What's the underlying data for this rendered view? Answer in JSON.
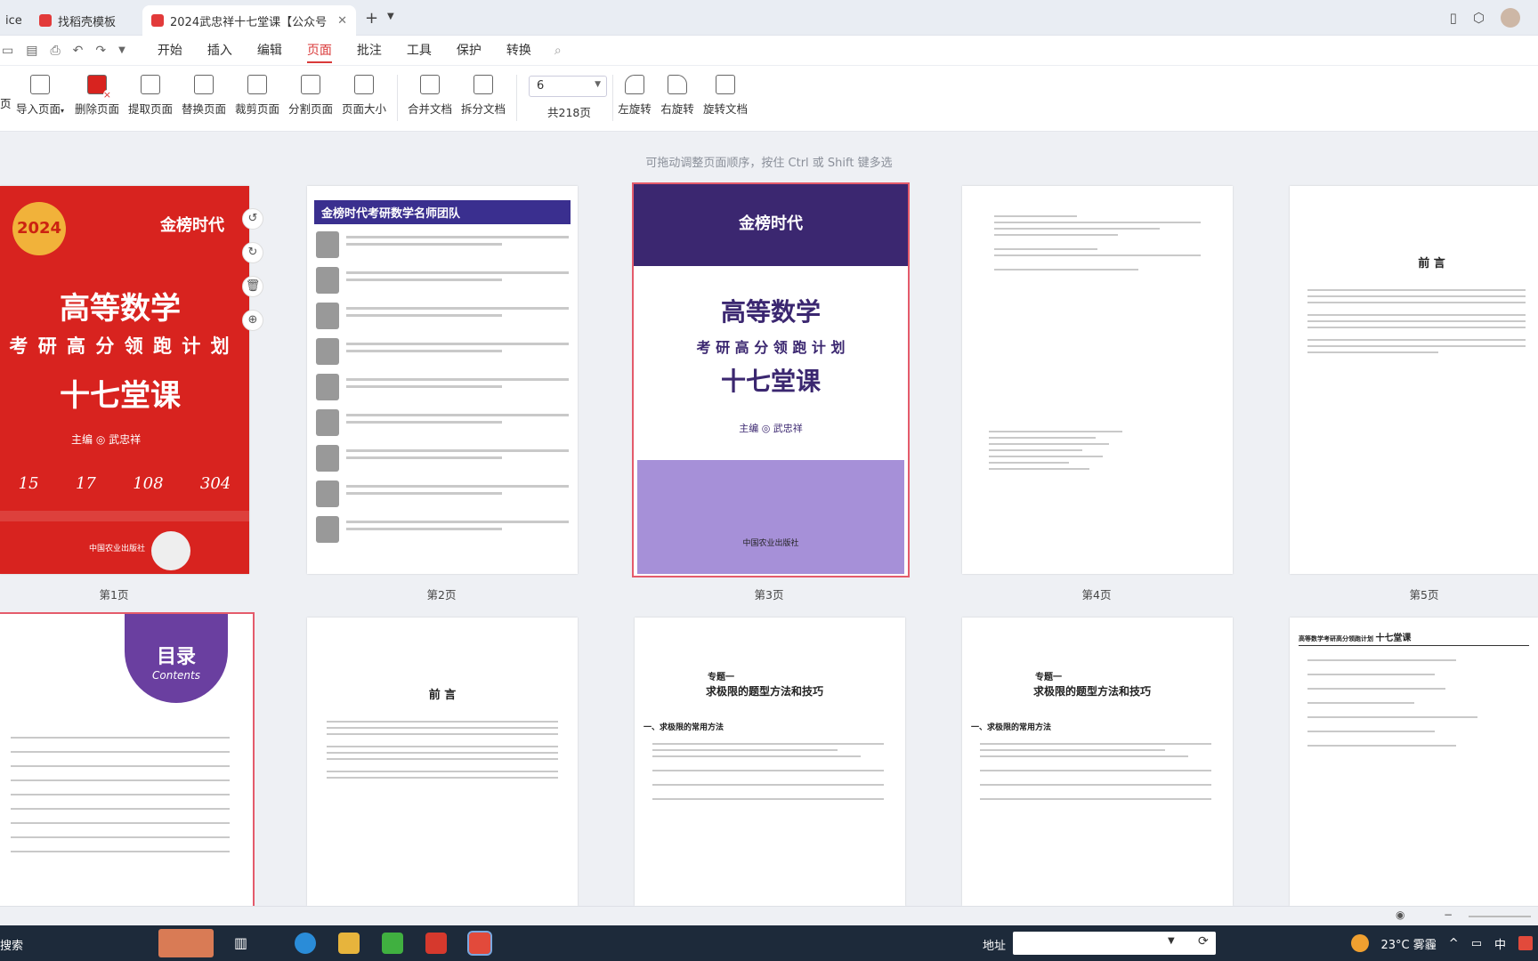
{
  "tabs": [
    {
      "label": "ice",
      "active": false,
      "color": "#777"
    },
    {
      "label": "找稻壳模板",
      "active": false,
      "color": "#e23a3a"
    },
    {
      "label": "2024武忠祥十七堂课【公众号",
      "active": true,
      "color": "#e23a3a"
    }
  ],
  "menus": [
    "开始",
    "插入",
    "编辑",
    "页面",
    "批注",
    "工具",
    "保护",
    "转换"
  ],
  "active_menu": "页面",
  "toolbar": {
    "buttons": [
      "导入页面",
      "删除页面",
      "提取页面",
      "替换页面",
      "裁剪页面",
      "分割页面",
      "页面大小",
      "合并文档",
      "拆分文档",
      "左旋转",
      "右旋转",
      "旋转文档"
    ],
    "page_value": "6",
    "total_pages": "共218页"
  },
  "hint": "可拖动调整页面顺序，按住 Ctrl 或 Shift 键多选",
  "pages": [
    {
      "label": "第1页"
    },
    {
      "label": "第2页"
    },
    {
      "label": "第3页"
    },
    {
      "label": "第4页"
    },
    {
      "label": "第5页"
    }
  ],
  "cover": {
    "brand": "金榜时代",
    "year": "2024",
    "title": "高等数学",
    "subtitle": "考 研 高 分 领 跑 计 划",
    "course": "十七堂课",
    "author": "主编 ◎ 武忠祥",
    "stats": [
      "15",
      "17",
      "108",
      "304"
    ],
    "publisher": "中国农业出版社"
  },
  "team": {
    "banner": "金榜时代考研数学名师团队"
  },
  "page3": {
    "brand": "金榜时代",
    "title": "高等数学",
    "subtitle": "考 研 高 分 领 跑 计 划",
    "course": "十七堂课",
    "author": "主编 ◎ 武忠祥",
    "publisher": "中国农业出版社"
  },
  "preface": {
    "title": "前 言"
  },
  "toc": {
    "title": "目录",
    "title_en": "Contents"
  },
  "topic": {
    "label": "专题一",
    "title": "求极限的题型方法和技巧",
    "section": "一、求极限的常用方法"
  },
  "page10": {
    "header": "高等数学考研高分领跑计划",
    "sub": "十七堂课"
  },
  "taskbar": {
    "search": "搜索",
    "address": "地址",
    "weather": "23°C 雾霾",
    "ime": "中"
  }
}
